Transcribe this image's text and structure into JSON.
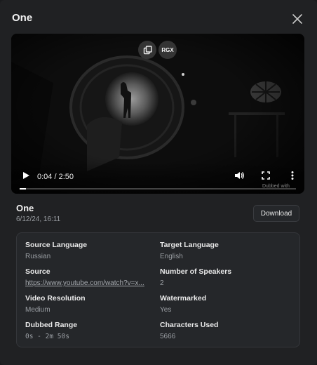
{
  "dialog": {
    "title": "One",
    "close_icon": "close-icon"
  },
  "video": {
    "overlay_buttons": {
      "copy_icon": "copy-icon",
      "rgx_label": "RGX"
    },
    "time": "0:04 / 2:50",
    "progress": 0.024,
    "watermark": "Dubbed with",
    "icons": {
      "play": "play-icon",
      "volume": "volume-icon",
      "fullscreen": "fullscreen-icon",
      "more": "more-vertical-icon"
    }
  },
  "meta": {
    "name": "One",
    "date": "6/12/24, 16:11",
    "download_label": "Download"
  },
  "details": {
    "source_language": {
      "label": "Source Language",
      "value": "Russian"
    },
    "target_language": {
      "label": "Target Language",
      "value": "English"
    },
    "source": {
      "label": "Source",
      "value": "https://www.youtube.com/watch?v=x..."
    },
    "speakers": {
      "label": "Number of Speakers",
      "value": "2"
    },
    "resolution": {
      "label": "Video Resolution",
      "value": "Medium"
    },
    "watermarked": {
      "label": "Watermarked",
      "value": "Yes"
    },
    "dubbed_range": {
      "label": "Dubbed Range",
      "value": "0s - 2m 50s"
    },
    "characters": {
      "label": "Characters Used",
      "value": "5666"
    }
  },
  "colors": {
    "background": "#202123",
    "card": "#25272a",
    "muted_text": "#9a9ea3"
  }
}
